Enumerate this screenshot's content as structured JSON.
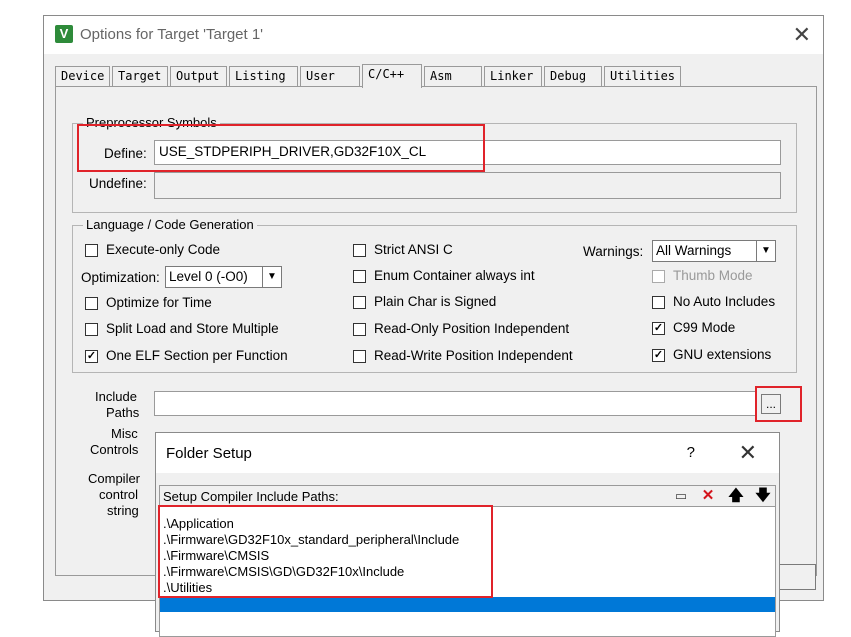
{
  "window": {
    "title": "Options for Target 'Target 1'",
    "icon_name": "keil-uvision-icon",
    "close_glyph": "✕"
  },
  "tabs": [
    {
      "label": "Device",
      "active": false
    },
    {
      "label": "Target",
      "active": false
    },
    {
      "label": "Output",
      "active": false
    },
    {
      "label": "Listing",
      "active": false
    },
    {
      "label": "User",
      "active": false
    },
    {
      "label": "C/C++",
      "active": true
    },
    {
      "label": "Asm",
      "active": false
    },
    {
      "label": "Linker",
      "active": false
    },
    {
      "label": "Debug",
      "active": false
    },
    {
      "label": "Utilities",
      "active": false
    }
  ],
  "preprocessor": {
    "group_title": "Preprocessor Symbols",
    "define_label": "Define:",
    "define_value": "USE_STDPERIPH_DRIVER,GD32F10X_CL",
    "undefine_label": "Undefine:",
    "undefine_value": ""
  },
  "language": {
    "group_title": "Language / Code Generation",
    "execute_only": {
      "label": "Execute-only Code",
      "checked": false
    },
    "optimization_label": "Optimization:",
    "optimization_value": "Level 0 (-O0)",
    "optimize_time": {
      "label": "Optimize for Time",
      "checked": false
    },
    "split_load": {
      "label": "Split Load and Store Multiple",
      "checked": false
    },
    "one_elf": {
      "label": "One ELF Section per Function",
      "checked": true
    },
    "strict_ansi": {
      "label": "Strict ANSI C",
      "checked": false
    },
    "enum_container": {
      "label": "Enum Container always int",
      "checked": false
    },
    "plain_char": {
      "label": "Plain Char is Signed",
      "checked": false
    },
    "ro_pi": {
      "label": "Read-Only Position Independent",
      "checked": false
    },
    "rw_pi": {
      "label": "Read-Write Position Independent",
      "checked": false
    },
    "warnings_label": "Warnings:",
    "warnings_value": "All Warnings",
    "thumb_mode": {
      "label": "Thumb Mode",
      "checked": false,
      "disabled": true
    },
    "no_auto_includes": {
      "label": "No Auto Includes",
      "checked": false
    },
    "c99_mode": {
      "label": "C99 Mode",
      "checked": true
    },
    "gnu_ext": {
      "label": "GNU extensions",
      "checked": true
    }
  },
  "include": {
    "include_label_1": "Include",
    "include_label_2": "Paths",
    "include_value": "",
    "browse_label": "...",
    "misc_label_1": "Misc",
    "misc_label_2": "Controls",
    "compiler_label_1": "Compiler",
    "compiler_label_2": "control",
    "compiler_label_3": "string"
  },
  "folder_setup": {
    "title": "Folder Setup",
    "help_glyph": "?",
    "close_glyph": "✕",
    "header_label": "Setup Compiler Include Paths:",
    "toolbar": [
      {
        "icon_name": "new-folder-icon",
        "glyph": "▭"
      },
      {
        "icon_name": "delete-icon",
        "glyph": "✕"
      },
      {
        "icon_name": "move-up-icon",
        "glyph": "🡅"
      },
      {
        "icon_name": "move-down-icon",
        "glyph": "🡇"
      }
    ],
    "paths": [
      ".\\Application",
      ".\\Firmware\\GD32F10x_standard_peripheral\\Include",
      ".\\Firmware\\CMSIS",
      ".\\Firmware\\CMSIS\\GD\\GD32F10x\\Include",
      ".\\Utilities"
    ],
    "selection_color": "#0078d7"
  },
  "colors": {
    "highlight_red": "#e0232a",
    "dialog_bg": "#f0f0f0"
  }
}
